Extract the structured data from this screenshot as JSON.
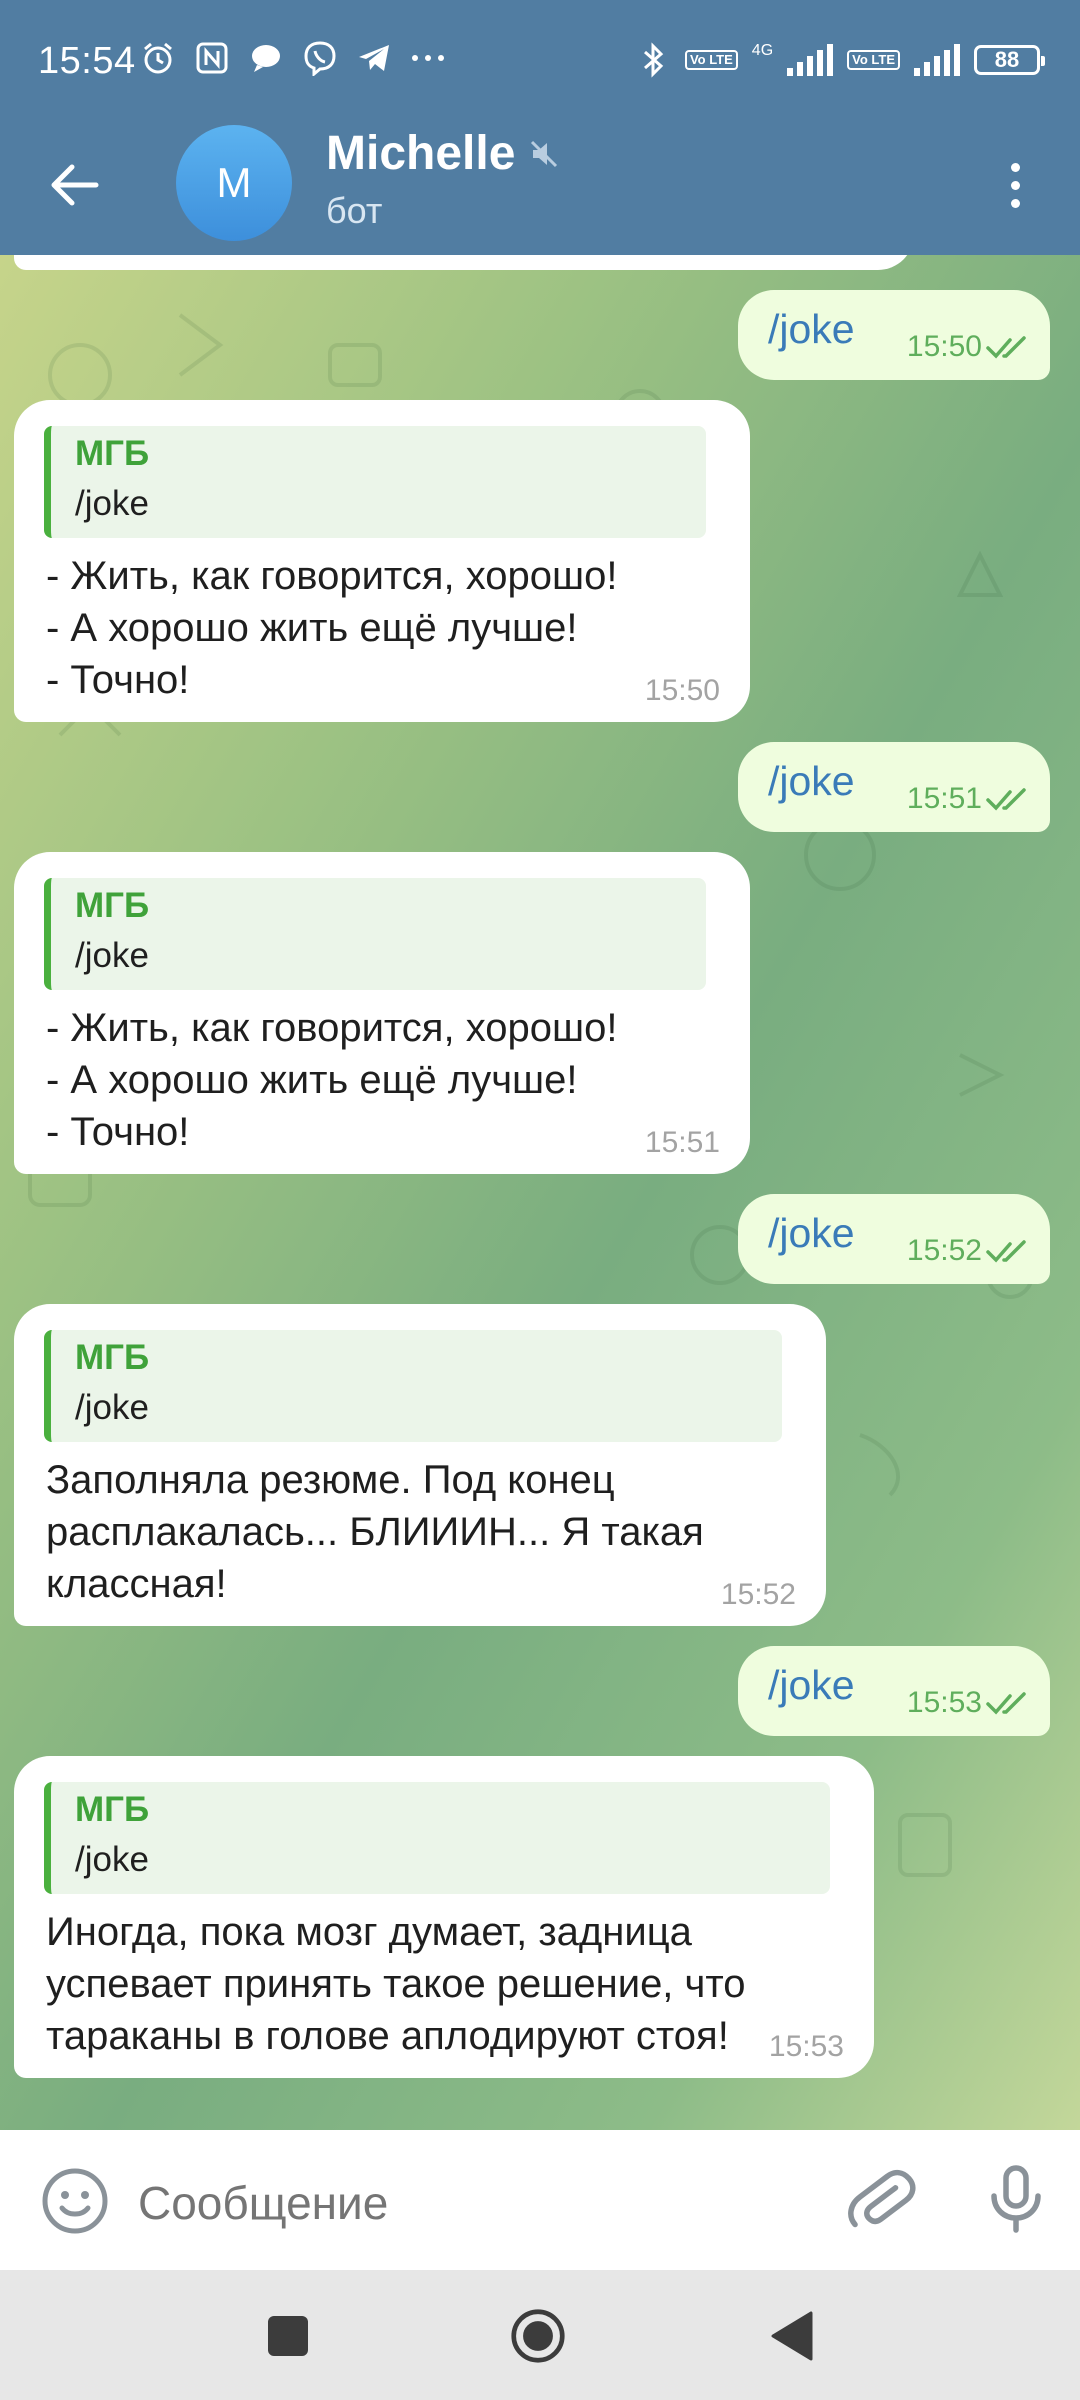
{
  "status_bar": {
    "time": "15:54",
    "icons": [
      "alarm-icon",
      "nfc-icon",
      "chat-bubble-icon",
      "viber-icon",
      "telegram-icon",
      "more-dots-icon"
    ],
    "network": "4G",
    "volte_label": "Vo LTE",
    "battery": "88"
  },
  "header": {
    "avatar_letter": "M",
    "name": "Michelle",
    "subtitle": "бот",
    "muted": true
  },
  "messages": [
    {
      "dir": "out",
      "text": "/joke",
      "time": "15:50",
      "read": true
    },
    {
      "dir": "in",
      "reply_name": "МГБ",
      "reply_text": "/joke",
      "text": "- Жить, как говорится, хорошо!\n- А хорошо жить ещё лучше!\n- Точно!",
      "time": "15:50"
    },
    {
      "dir": "out",
      "text": "/joke",
      "time": "15:51",
      "read": true
    },
    {
      "dir": "in",
      "reply_name": "МГБ",
      "reply_text": "/joke",
      "text": "- Жить, как говорится, хорошо!\n- А хорошо жить ещё лучше!\n- Точно!",
      "time": "15:51"
    },
    {
      "dir": "out",
      "text": "/joke",
      "time": "15:52",
      "read": true
    },
    {
      "dir": "in",
      "reply_name": "МГБ",
      "reply_text": "/joke",
      "text": "Заполняла резюме. Под конец\nрасплакалась... БЛИИИН... Я такая\nклассная!",
      "time": "15:52"
    },
    {
      "dir": "out",
      "text": "/joke",
      "time": "15:53",
      "read": true
    },
    {
      "dir": "in",
      "reply_name": "МГБ",
      "reply_text": "/joke",
      "text": "Иногда, пока мозг думает, задница\nуспевает принять такое решение, что\nтараканы в голове аплодируют стоя!",
      "time": "15:53"
    }
  ],
  "input": {
    "placeholder": "Сообщение"
  },
  "colors": {
    "header": "#517da2",
    "outgoing_bubble": "#effdde",
    "incoming_bubble": "#ffffff",
    "reply_accent": "#4ab03e",
    "command_link": "#3a7bb8"
  }
}
